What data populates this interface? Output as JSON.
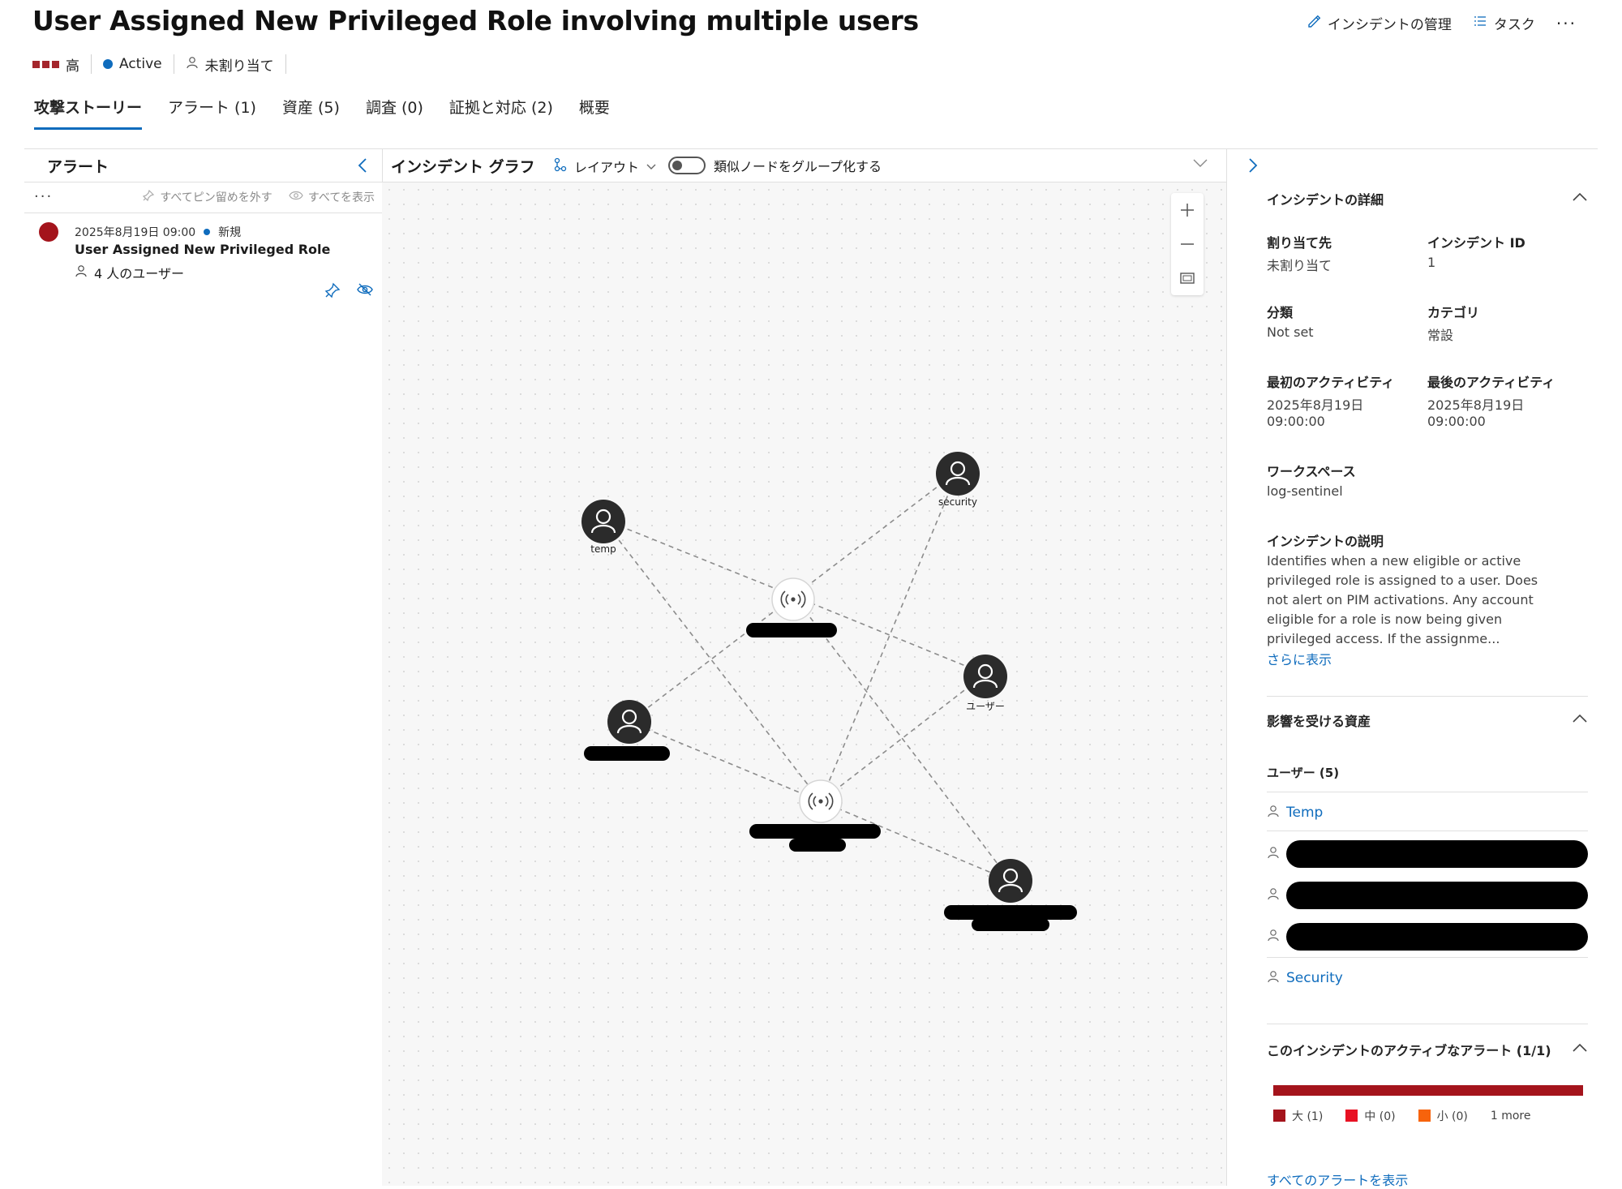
{
  "header": {
    "title": "User Assigned New Privileged Role involving multiple users",
    "manage_label": "インシデントの管理",
    "tasks_label": "タスク",
    "more_label": "···"
  },
  "status": {
    "severity": "高",
    "state": "Active",
    "assignee": "未割り当て",
    "severity_color": "#a4262c",
    "state_color": "#0f6cbd"
  },
  "tabs": [
    {
      "label": "攻撃ストーリー",
      "active": true
    },
    {
      "label": "アラート (1)"
    },
    {
      "label": "資産 (5)"
    },
    {
      "label": "調査 (0)"
    },
    {
      "label": "証拠と対応 (2)"
    },
    {
      "label": "概要"
    }
  ],
  "alerts_panel": {
    "title": "アラート",
    "more": "···",
    "unpin_all": "すべてピン留めを外す",
    "show_all": "すべてを表示",
    "alert": {
      "timestamp": "2025年8月19日 09:00",
      "status": "新規",
      "title": "User Assigned New Privileged Role",
      "users": "4 人のユーザー"
    }
  },
  "graph": {
    "title": "インシデント グラフ",
    "layout_label": "レイアウト",
    "group_label": "類似ノードをグループ化する",
    "nodes": {
      "temp": "temp",
      "security": "security",
      "user": "ユーザー"
    }
  },
  "details": {
    "section_title": "インシデントの詳細",
    "assigned_label": "割り当て先",
    "assigned_value": "未割り当て",
    "id_label": "インシデント ID",
    "id_value": "1",
    "classification_label": "分類",
    "classification_value": "Not set",
    "category_label": "カテゴリ",
    "category_value": "常設",
    "first_label": "最初のアクティビティ",
    "first_date": "2025年8月19日",
    "first_time": "09:00:00",
    "last_label": "最後のアクティビティ",
    "last_date": "2025年8月19日",
    "last_time": "09:00:00",
    "workspace_label": "ワークスペース",
    "workspace_value": "log-sentinel",
    "description_label": "インシデントの説明",
    "description": "Identifies when a new eligible or active privileged role is assigned to a user. Does not alert on PIM activations. Any account eligible for a role is now being given privileged access. If the assignme...",
    "show_more": "さらに表示"
  },
  "assets": {
    "section_title": "影響を受ける資産",
    "users_header": "ユーザー (5)",
    "user_first": "Temp",
    "user_last": "Security"
  },
  "active_alerts": {
    "section_title": "このインシデントのアクティブなアラート (1/1)",
    "high": "大 (1)",
    "medium": "中 (0)",
    "low": "小 (0)",
    "more": "1 more",
    "high_color": "#a4141c",
    "medium_color": "#e81123",
    "low_color": "#f7630c",
    "view_all": "すべてのアラートを表示"
  }
}
